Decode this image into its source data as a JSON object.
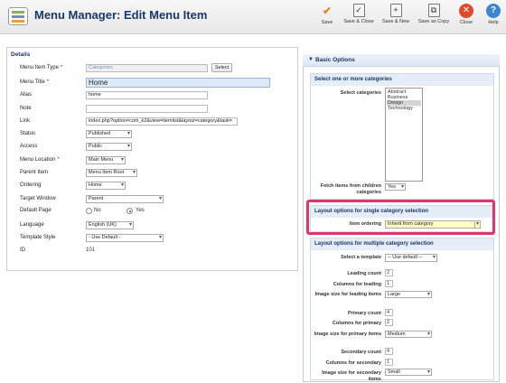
{
  "header": {
    "title": "Menu Manager: Edit Menu Item"
  },
  "toolbar": {
    "save": "Save",
    "save_close": "Save & Close",
    "save_new": "Save & New",
    "save_copy": "Save as Copy",
    "close": "Close",
    "help": "Help"
  },
  "details": {
    "legend": "Details",
    "menu_item_type_label": "Menu Item Type",
    "menu_item_type_value": "Categories",
    "select_button": "Select",
    "menu_title_label": "Menu Title",
    "menu_title_value": "Home",
    "alias_label": "Alias",
    "alias_value": "home",
    "note_label": "Note",
    "note_value": "",
    "link_label": "Link",
    "link_value": "index.php?option=com_k2&view=itemlist&layout=category&task=",
    "status_label": "Status",
    "status_value": "Published",
    "access_label": "Access",
    "access_value": "Public",
    "menu_location_label": "Menu Location",
    "menu_location_value": "Main Menu",
    "parent_item_label": "Parent Item",
    "parent_item_value": "Menu Item Root",
    "ordering_label": "Ordering",
    "ordering_value": "Home",
    "target_window_label": "Target Window",
    "target_window_value": "Parent",
    "default_page_label": "Default Page",
    "default_no": "No",
    "default_yes": "Yes",
    "language_label": "Language",
    "language_value": "English (UK)",
    "template_style_label": "Template Style",
    "template_style_value": "- Use Default -",
    "id_label": "ID",
    "id_value": "101",
    "required_mark": "*"
  },
  "basic_options": {
    "header": "Basic Options",
    "arrow": "▼",
    "categories_section": "Select one or more categories",
    "select_categories_label": "Select categories",
    "categories": [
      "Abstract",
      "Business",
      "Design",
      "Technology"
    ],
    "selected_category": "Design",
    "fetch_children_label": "Fetch items from children categories",
    "fetch_children_value": "Yes",
    "single_section": "Layout options for single category selection",
    "item_ordering_label": "Item ordering",
    "item_ordering_value": "Inherit from category",
    "multi_section": "Layout options for multiple category selection",
    "select_template_label": "Select a template",
    "select_template_value": "-- Use default --",
    "leading_count_label": "Leading count",
    "leading_count_value": "2",
    "columns_leading_label": "Columns for leading",
    "columns_leading_value": "1",
    "image_size_leading_label": "Image size for leading items",
    "image_size_leading_value": "Large",
    "primary_count_label": "Primary count",
    "primary_count_value": "4",
    "columns_primary_label": "Columns for primary",
    "columns_primary_value": "2",
    "image_size_primary_label": "Image size for primary items",
    "image_size_primary_value": "Medium",
    "secondary_count_label": "Secondary count",
    "secondary_count_value": "4",
    "columns_secondary_label": "Columns for secondary",
    "columns_secondary_value": "1",
    "image_size_secondary_label": "Image size for secondary items",
    "image_size_secondary_value": "Small"
  },
  "colors": {
    "highlight": "#e0346a",
    "title": "#1a3867",
    "section_bg": "#e4edf8"
  }
}
